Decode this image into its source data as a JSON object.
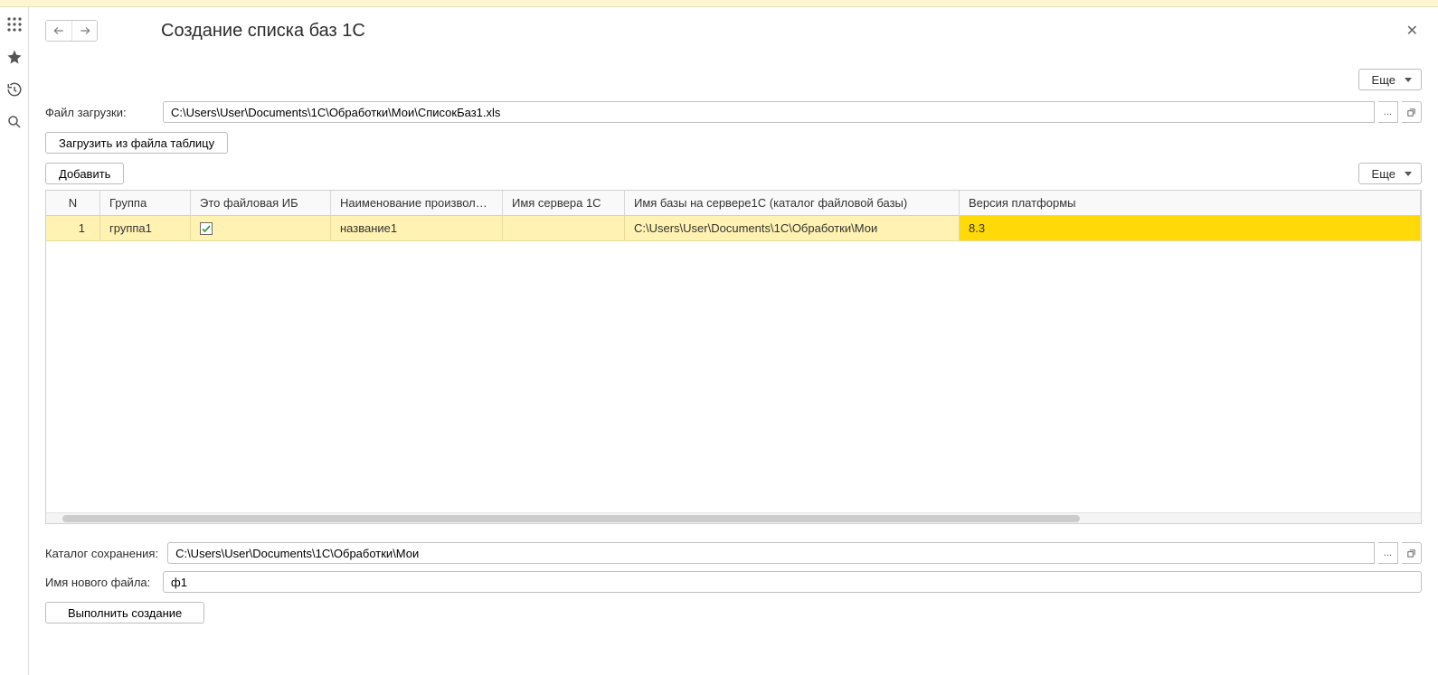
{
  "header": {
    "title": "Создание списка баз 1С"
  },
  "controls": {
    "more_label": "Еще",
    "load_from_file_label": "Загрузить из файла таблицу",
    "add_label": "Добавить",
    "execute_label": "Выполнить создание"
  },
  "fields": {
    "upload_label": "Файл загрузки:",
    "upload_value": "C:\\Users\\User\\Documents\\1C\\Обработки\\Мои\\СписокБаз1.xls",
    "save_dir_label": "Каталог сохранения:",
    "save_dir_value": "C:\\Users\\User\\Documents\\1C\\Обработки\\Мои",
    "new_file_label": "Имя нового файла:",
    "new_file_value": "ф1"
  },
  "table": {
    "columns": {
      "n": "N",
      "group": "Группа",
      "is_file": "Это файловая ИБ",
      "name": "Наименование произвольн...",
      "server": "Имя сервера 1С",
      "db": "Имя базы на сервере1С (каталог файловой базы)",
      "platform": "Версия платформы"
    },
    "rows": [
      {
        "n": "1",
        "group": "группа1",
        "is_file": true,
        "name": "название1",
        "server": "",
        "db": "C:\\Users\\User\\Documents\\1C\\Обработки\\Мои",
        "platform": "8.3"
      }
    ]
  }
}
